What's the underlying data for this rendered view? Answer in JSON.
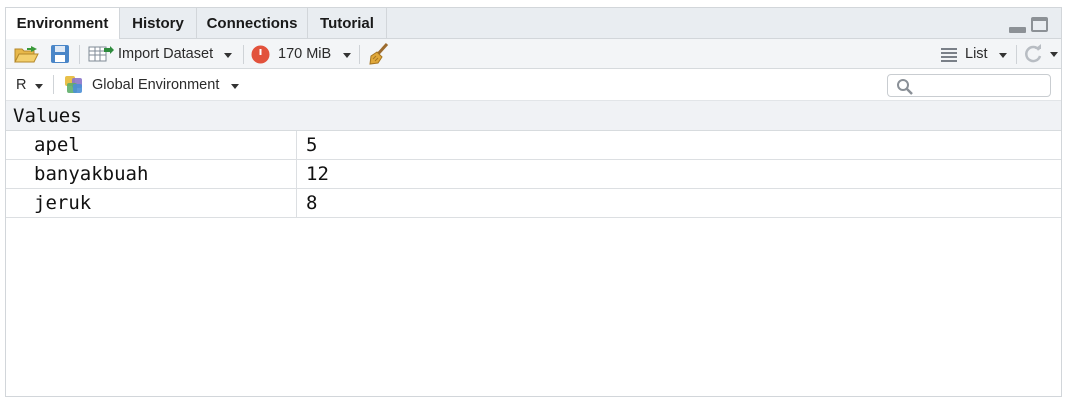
{
  "tabs": [
    {
      "label": "Environment",
      "active": true
    },
    {
      "label": "History",
      "active": false
    },
    {
      "label": "Connections",
      "active": false
    },
    {
      "label": "Tutorial",
      "active": false
    }
  ],
  "toolbar": {
    "import_dataset_label": "Import Dataset",
    "memory_label": "170 MiB",
    "view_mode_label": "List"
  },
  "env_bar": {
    "language_label": "R",
    "environment_label": "Global Environment",
    "search_placeholder": ""
  },
  "section": {
    "title": "Values"
  },
  "values": [
    {
      "name": "apel",
      "value": "5"
    },
    {
      "name": "banyakbuah",
      "value": "12"
    },
    {
      "name": "jeruk",
      "value": "8"
    }
  ],
  "colors": {
    "tab_bar_bg": "#e9edf1",
    "toolbar_bg": "#f3f5f7",
    "memory_icon": "#e2523c",
    "save_icon": "#4a86c8"
  },
  "icons": [
    "open-folder-icon",
    "save-icon",
    "import-dataset-icon",
    "memory-usage-icon",
    "broom-icon",
    "list-lines-icon",
    "refresh-icon",
    "r-logo-icon",
    "global-env-icon",
    "search-icon",
    "minimize-icon",
    "maximize-icon"
  ]
}
